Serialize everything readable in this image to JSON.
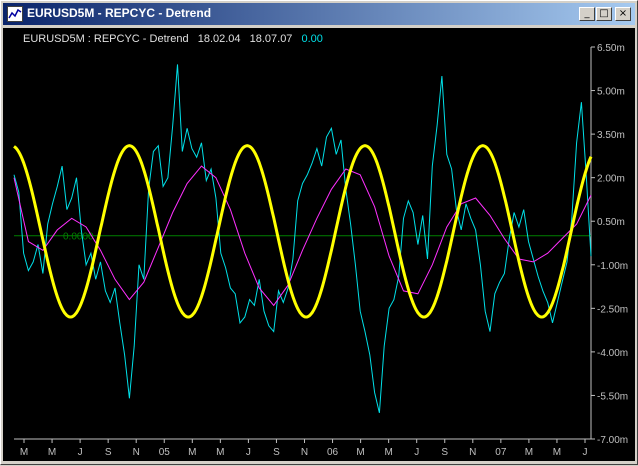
{
  "window": {
    "title": "EURUSD5M - REPCYC - Detrend",
    "buttons": {
      "minimize": "_",
      "maximize": "□",
      "close": "×"
    }
  },
  "colors": {
    "background": "#000000",
    "axis": "#c0c0c0",
    "price": "#00e0e8",
    "smooth": "#ff30ff",
    "cycle": "#ffff00",
    "zero": "#008000",
    "header_value": "#00e0e8"
  },
  "chart_data": {
    "type": "line",
    "header": {
      "symbol": "EURUSD5M : REPCYC - Detrend",
      "start": "18.02.04",
      "end": "18.07.07",
      "value": "0.00"
    },
    "zero_label": "0.0000",
    "ylim": [
      -7.0,
      6.5
    ],
    "y_ticks": [
      {
        "v": 6.5,
        "label": "6.50m"
      },
      {
        "v": 5.0,
        "label": "5.00m"
      },
      {
        "v": 3.5,
        "label": "3.50m"
      },
      {
        "v": 2.0,
        "label": "2.00m"
      },
      {
        "v": 0.5,
        "label": "0.50m"
      },
      {
        "v": -1.0,
        "label": "-1.00m"
      },
      {
        "v": -2.5,
        "label": "-2.50m"
      },
      {
        "v": -4.0,
        "label": "-4.00m"
      },
      {
        "v": -5.5,
        "label": "-5.50m"
      },
      {
        "v": -7.0,
        "label": "-7.00m"
      }
    ],
    "x_ticks": [
      "M",
      "M",
      "J",
      "S",
      "N",
      "05",
      "M",
      "M",
      "J",
      "S",
      "N",
      "06",
      "M",
      "M",
      "J",
      "S",
      "N",
      "07",
      "M",
      "M",
      "J"
    ],
    "series": [
      {
        "key": "price",
        "x": [
          0,
          2,
          4,
          6,
          8,
          10,
          12,
          14,
          16,
          18,
          20,
          22,
          24,
          26,
          28,
          30,
          32,
          34,
          36,
          38,
          40,
          42,
          44,
          46,
          48,
          50,
          52,
          54,
          56,
          58,
          60,
          62,
          64,
          66,
          68,
          70,
          72,
          74,
          76,
          78,
          80,
          82,
          84,
          86,
          88,
          90,
          92,
          94,
          96,
          98,
          100,
          102,
          104,
          106,
          108,
          110,
          112,
          114,
          116,
          118,
          120,
          122,
          124,
          126,
          128,
          130,
          132,
          134,
          136,
          138,
          140,
          142,
          144,
          146,
          148,
          150,
          152,
          154,
          156,
          158,
          160,
          162,
          164,
          166,
          168,
          170,
          172,
          174,
          176,
          178,
          180,
          182,
          184,
          186,
          188,
          190,
          192,
          194,
          196,
          198,
          200,
          202,
          204,
          206,
          208,
          210,
          212,
          214,
          216,
          218,
          220,
          222,
          224,
          226,
          228,
          230,
          232,
          234,
          236,
          238,
          240
        ],
        "y": [
          2.1,
          1.5,
          -0.6,
          -1.2,
          -0.9,
          -0.3,
          -1.3,
          0.4,
          1.1,
          1.7,
          2.4,
          0.9,
          1.3,
          2.0,
          0.2,
          -1.0,
          -0.6,
          -1.5,
          -0.9,
          -1.9,
          -2.3,
          -1.8,
          -3.0,
          -4.1,
          -5.6,
          -3.8,
          -1.0,
          -1.5,
          1.6,
          2.9,
          3.1,
          1.7,
          2.0,
          3.8,
          5.9,
          2.9,
          3.7,
          3.0,
          2.7,
          3.2,
          1.9,
          2.3,
          1.3,
          -0.6,
          -1.1,
          -1.8,
          -2.0,
          -3.0,
          -2.8,
          -2.2,
          -2.4,
          -1.5,
          -2.6,
          -3.1,
          -3.3,
          -1.9,
          -2.3,
          -1.8,
          -0.8,
          1.2,
          1.8,
          2.1,
          2.5,
          3.0,
          2.4,
          3.4,
          3.7,
          2.8,
          3.3,
          1.6,
          0.4,
          -1.0,
          -2.6,
          -3.3,
          -4.1,
          -5.4,
          -6.1,
          -3.8,
          -2.5,
          -2.2,
          -1.4,
          0.6,
          1.2,
          0.8,
          -0.3,
          0.7,
          -0.8,
          2.4,
          3.8,
          5.5,
          2.8,
          2.3,
          0.9,
          0.2,
          1.1,
          0.6,
          0.2,
          -1.0,
          -2.6,
          -3.3,
          -2.0,
          -1.6,
          -1.3,
          -0.1,
          0.8,
          0.3,
          0.9,
          -0.2,
          -0.8,
          -1.4,
          -1.9,
          -2.3,
          -3.0,
          -2.3,
          -1.6,
          -0.9,
          0.6,
          3.2,
          4.6,
          2.1,
          -0.7
        ]
      },
      {
        "key": "smooth",
        "x": [
          0,
          6,
          12,
          18,
          24,
          30,
          36,
          42,
          48,
          54,
          60,
          66,
          72,
          78,
          84,
          90,
          96,
          102,
          108,
          114,
          120,
          126,
          132,
          138,
          144,
          150,
          156,
          162,
          168,
          174,
          180,
          186,
          192,
          198,
          204,
          210,
          216,
          222,
          228,
          234,
          240
        ],
        "y": [
          2.0,
          -0.2,
          -0.5,
          0.2,
          0.6,
          0.3,
          -0.5,
          -1.5,
          -2.2,
          -1.6,
          -0.4,
          0.8,
          1.8,
          2.4,
          2.0,
          0.9,
          -0.6,
          -1.8,
          -2.4,
          -1.7,
          -0.5,
          0.6,
          1.6,
          2.3,
          2.1,
          1.0,
          -0.7,
          -1.9,
          -2.0,
          -1.0,
          0.3,
          1.1,
          1.3,
          0.7,
          -0.1,
          -0.8,
          -0.9,
          -0.6,
          -0.1,
          0.4,
          1.4
        ]
      }
    ],
    "cycle": {
      "amplitude": 2.95,
      "offset": 0.15,
      "period": 49,
      "phase_x": -1,
      "x_start": 0,
      "x_end": 240
    }
  }
}
